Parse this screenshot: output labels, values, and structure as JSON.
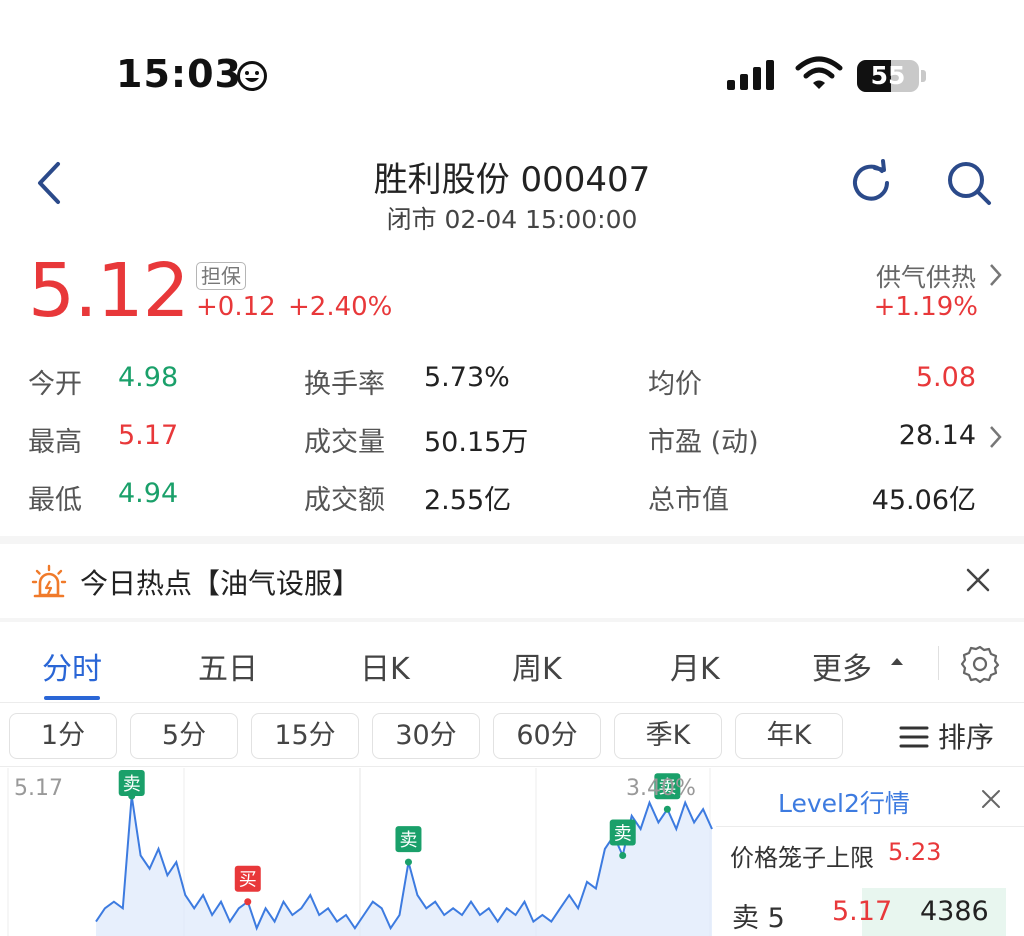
{
  "status_bar": {
    "time": "15:03",
    "battery": "55"
  },
  "header": {
    "title": "胜利股份 000407",
    "subtitle": "闭市 02-04 15:00:00"
  },
  "quote": {
    "price": "5.12",
    "badge": "担保",
    "change": "+0.12",
    "change_pct": "+2.40%",
    "sector": "供气供热",
    "sector_pct": "+1.19%"
  },
  "stats": {
    "open_label": "今开",
    "open": "4.98",
    "high_label": "最高",
    "high": "5.17",
    "low_label": "最低",
    "low": "4.94",
    "turnover_label": "换手率",
    "turnover": "5.73%",
    "volume_label": "成交量",
    "volume": "50.15万",
    "amount_label": "成交额",
    "amount": "2.55亿",
    "avg_label": "均价",
    "avg": "5.08",
    "pe_label": "市盈 (动)",
    "pe": "28.14",
    "mcap_label": "总市值",
    "mcap": "45.06亿"
  },
  "hot": {
    "text": "今日热点【油气设服】"
  },
  "tabs": [
    "分时",
    "五日",
    "日K",
    "周K",
    "月K",
    "更多"
  ],
  "subtabs": [
    "1分",
    "5分",
    "15分",
    "30分",
    "60分",
    "季K",
    "年K"
  ],
  "sort_label": "排序",
  "chart": {
    "y_top": "5.17",
    "pct_top": "3.40%",
    "markers": [
      {
        "label": "卖",
        "type": "sell"
      },
      {
        "label": "买",
        "type": "buy"
      },
      {
        "label": "卖",
        "type": "sell"
      },
      {
        "label": "卖",
        "type": "sell"
      },
      {
        "label": "卖",
        "type": "sell"
      }
    ]
  },
  "chart_data": {
    "type": "line",
    "title": "",
    "y_labels": [
      "5.17",
      "3.40%"
    ],
    "series": [
      {
        "values": [
          4.98,
          5.0,
          5.01,
          5.0,
          5.17,
          5.08,
          5.06,
          5.09,
          5.05,
          5.07,
          5.02,
          5.0,
          5.02,
          4.99,
          5.01,
          4.98,
          5.0,
          5.01,
          4.97,
          5.0,
          4.98,
          5.01,
          4.99,
          5.0,
          5.02,
          4.99,
          5.0,
          4.98,
          4.99,
          4.97,
          4.99,
          5.01,
          5.0,
          4.97,
          4.99,
          5.07,
          5.02,
          5.0,
          5.01,
          4.99,
          5.0,
          4.99,
          5.01,
          4.99,
          5.0,
          4.98,
          5.0,
          4.99,
          5.01,
          4.98,
          4.99,
          4.98,
          5.0,
          5.02,
          5.0,
          5.04,
          5.03,
          5.09,
          5.11,
          5.08,
          5.14,
          5.12,
          5.16,
          5.13,
          5.15,
          5.12,
          5.16,
          5.13,
          5.15,
          5.12
        ]
      }
    ],
    "markers": [
      {
        "label": "卖",
        "index": 4
      },
      {
        "label": "买",
        "index": 17
      },
      {
        "label": "卖",
        "index": 35
      },
      {
        "label": "卖",
        "index": 59
      },
      {
        "label": "卖",
        "index": 64
      }
    ]
  },
  "level2": {
    "title": "Level2行情",
    "cap_label": "价格笼子上限",
    "cap_value": "5.23",
    "row_label": "卖 5",
    "row_price": "5.17",
    "row_volume": "4386"
  },
  "colors": {
    "up": "#e8383a",
    "down": "#1aa06a",
    "accent": "#2a66d6",
    "line": "#3d7be0"
  }
}
